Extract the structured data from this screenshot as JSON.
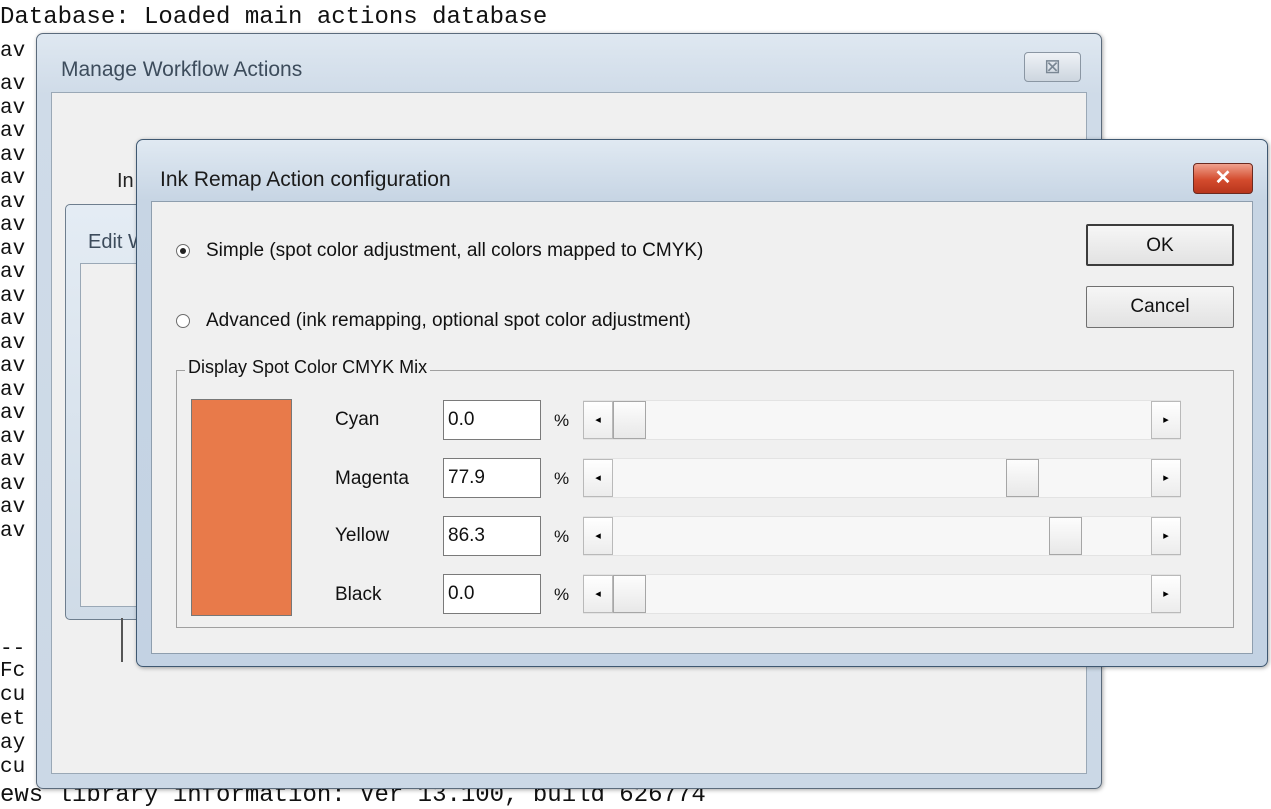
{
  "console": {
    "first_line": "Database: Loaded main actions database",
    "left_fragments": [
      "av",
      "av",
      "av",
      "av",
      "av",
      "av",
      "av",
      "av",
      "av",
      "av",
      "av",
      "av",
      "av",
      "av",
      "av",
      "av",
      "av",
      "av",
      "av",
      "av",
      "av"
    ],
    "lower_fragments": [
      "--",
      "Fc",
      "cu",
      "et",
      "ay",
      "cu"
    ],
    "bottom_line": "ews library information: Ver 13.100, build 626774"
  },
  "manage_window": {
    "title": "Manage Workflow Actions",
    "close_symbol": "⊠",
    "partial_label": "In",
    "inner_title": "Edit W"
  },
  "ink_window": {
    "title": "Ink Remap Action configuration",
    "close_symbol": "✕",
    "radio_simple": "Simple (spot color adjustment, all colors mapped to CMYK)",
    "radio_advanced": "Advanced (ink remapping, optional spot color adjustment)",
    "selected_mode": "simple",
    "ok_label": "OK",
    "cancel_label": "Cancel",
    "group_label": "Display Spot Color CMYK Mix",
    "swatch_color": "#e87a4a",
    "channels": [
      {
        "name": "Cyan",
        "value": "0.0",
        "percent": 0.0
      },
      {
        "name": "Magenta",
        "value": "77.9",
        "percent": 77.9
      },
      {
        "name": "Yellow",
        "value": "86.3",
        "percent": 86.3
      },
      {
        "name": "Black",
        "value": "0.0",
        "percent": 0.0
      }
    ],
    "percent_symbol": "%",
    "arrow_left": "◂",
    "arrow_right": "▸"
  }
}
